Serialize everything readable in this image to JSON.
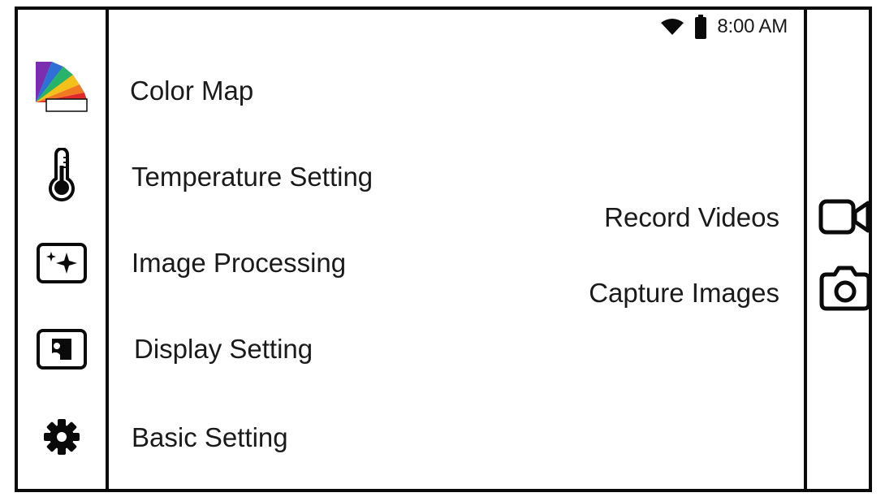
{
  "status": {
    "wifi_icon": "wifi-icon",
    "battery_icon": "battery-icon",
    "time": "8:00 AM"
  },
  "menu": {
    "items": [
      {
        "label": "Color Map",
        "icon": "color-map-icon"
      },
      {
        "label": "Temperature Setting",
        "icon": "thermometer-icon"
      },
      {
        "label": "Image Processing",
        "icon": "sparkle-image-icon"
      },
      {
        "label": "Display Setting",
        "icon": "display-icon"
      },
      {
        "label": "Basic Setting",
        "icon": "gear-icon"
      }
    ]
  },
  "actions": {
    "record_label": "Record Videos",
    "record_icon": "video-camera-icon",
    "capture_label": "Capture Images",
    "capture_icon": "camera-icon"
  },
  "colors": {
    "border": "#0a0a0a",
    "palette": [
      "#7b2fb0",
      "#2f6fd6",
      "#27b36a",
      "#f2c21b",
      "#f07a22",
      "#e02a2a"
    ]
  }
}
